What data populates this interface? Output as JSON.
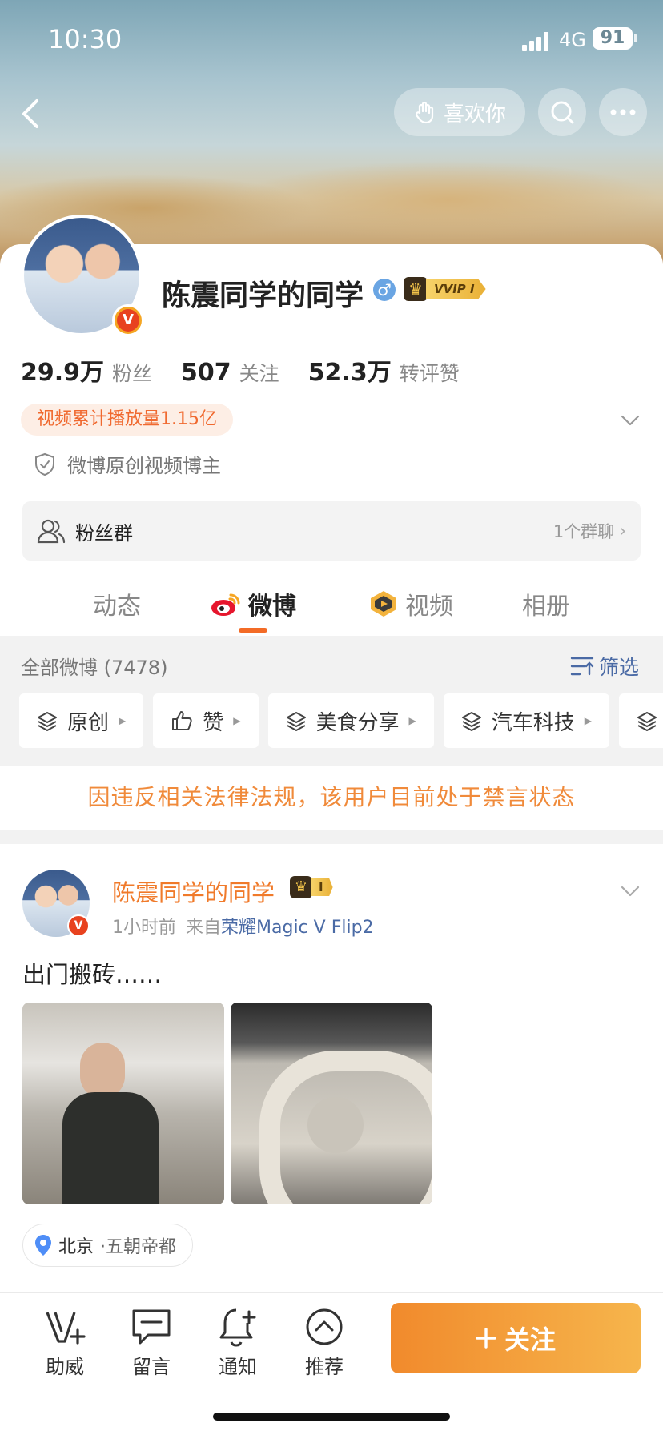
{
  "status_bar": {
    "time": "10:30",
    "network": "4G",
    "battery": "91"
  },
  "header": {
    "like_label": "喜欢你"
  },
  "profile": {
    "name": "陈震同学的同学",
    "gender_symbol": "♂",
    "vip_label": "VVIP I",
    "stats": [
      {
        "num": "29.9万",
        "label": "粉丝"
      },
      {
        "num": "507",
        "label": "关注"
      },
      {
        "num": "52.3万",
        "label": "转评赞"
      }
    ],
    "play_count": "视频累计播放量1.15亿",
    "verification": "微博原创视频博主",
    "fan_group": {
      "label": "粉丝群",
      "count": "1个群聊"
    }
  },
  "tabs": [
    {
      "label": "动态"
    },
    {
      "label": "微博"
    },
    {
      "label": "视频"
    },
    {
      "label": "相册"
    }
  ],
  "feed": {
    "all_label": "全部微博 (7478)",
    "filter_label": "筛选",
    "chips": [
      "原创",
      "赞",
      "美食分享",
      "汽车科技"
    ],
    "banned_notice": "因违反相关法律法规，该用户目前处于禁言状态"
  },
  "post": {
    "author": "陈震同学的同学",
    "vip_level": "I",
    "time": "1小时前",
    "source_prefix": "来自",
    "device": "荣耀Magic V Flip2",
    "text": "出门搬砖……",
    "location": "北京",
    "location_sub": "·五朝帝都"
  },
  "bottom_bar": {
    "items": [
      "助威",
      "留言",
      "通知",
      "推荐"
    ],
    "follow_label": "关注"
  },
  "colors": {
    "accent": "#f36b26",
    "link": "#4a6aa5",
    "follow_start": "#f18a2c",
    "follow_end": "#f6b54c"
  }
}
